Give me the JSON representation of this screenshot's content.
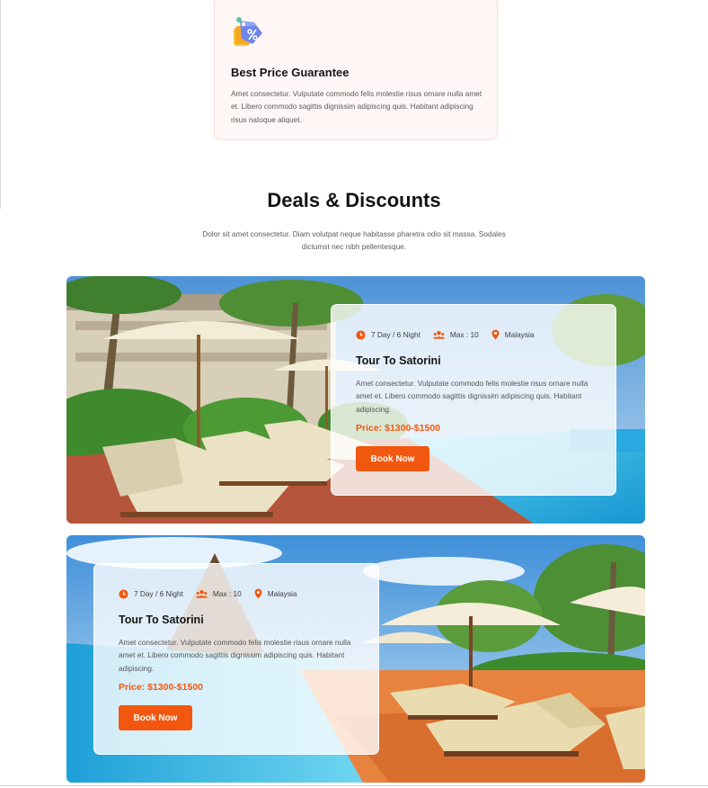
{
  "feature": {
    "icon": "percent-tag-icon",
    "title": "Best Price Guarantee",
    "text": "Amet consectetur. Vulputate commodo felis molestie risus  ornare nulla amet et. Libero commodo sagittis dignissim adipiscing quis. Habitant adipiscing risus natoque aliquet."
  },
  "section": {
    "title": "Deals & Discounts",
    "subtitle": "Dolor sit amet consectetur. Diam volutpat neque habitasse pharetra odio sit massa. Sodales dictumst nec nibh pellentesque."
  },
  "deals": [
    {
      "duration": "7 Day / 6 Night",
      "capacity": "Max : 10",
      "location": "Malaysia",
      "title": "Tour To Satorini",
      "description": "Amet consectetur. Vulputate commodo felis molestie risus  ornare nulla amet et. Libero commodo sagittis dignissim adipiscing quis. Habitant adipiscing.",
      "price": "Price: $1300-$1500",
      "button": "Book Now",
      "photo": "resort-pool-umbrellas-photo"
    },
    {
      "duration": "7 Day / 6 Night",
      "capacity": "Max : 10",
      "location": "Malaysia",
      "title": "Tour To Satorini",
      "description": "Amet consectetur. Vulputate commodo felis molestie risus  ornare nulla amet et. Libero commodo sagittis dignissim adipiscing quis. Habitant adipiscing.",
      "price": "Price: $1300-$1500",
      "button": "Book Now",
      "photo": "beach-pool-loungers-photo"
    }
  ],
  "colors": {
    "accent": "#f2570f",
    "feature_bg": "#fff7f6",
    "title": "#151515"
  },
  "icons": {
    "duration": "clock-icon",
    "capacity": "people-icon",
    "location": "location-pin-icon"
  }
}
